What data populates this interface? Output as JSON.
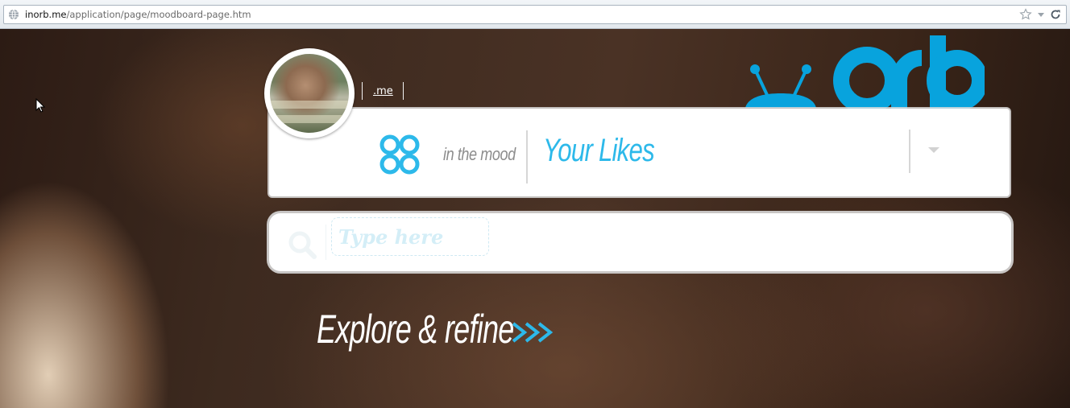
{
  "browser": {
    "url_domain": "inorb.me",
    "url_path": "/application/page/moodboard-page.htm",
    "icons": [
      "globe-icon",
      "star-icon",
      "dropdown-arrow-icon",
      "reload-icon"
    ]
  },
  "header": {
    "profile_link": ".me",
    "logo": "orb-logo"
  },
  "mood": {
    "icon": "mood-icon",
    "prefix": "in the mood",
    "selected": "Your Likes",
    "dropdown_icon": "caret-down-icon"
  },
  "search": {
    "icon": "search-icon",
    "placeholder": "Type here",
    "value": ""
  },
  "explore": {
    "label": "Explore & refine",
    "icon": "chevrons-right-icon"
  },
  "colors": {
    "accent": "#2db9ea",
    "logo": "#08a3dd",
    "muted_text": "#8c8c8c",
    "placeholder": "#d4eef7"
  }
}
